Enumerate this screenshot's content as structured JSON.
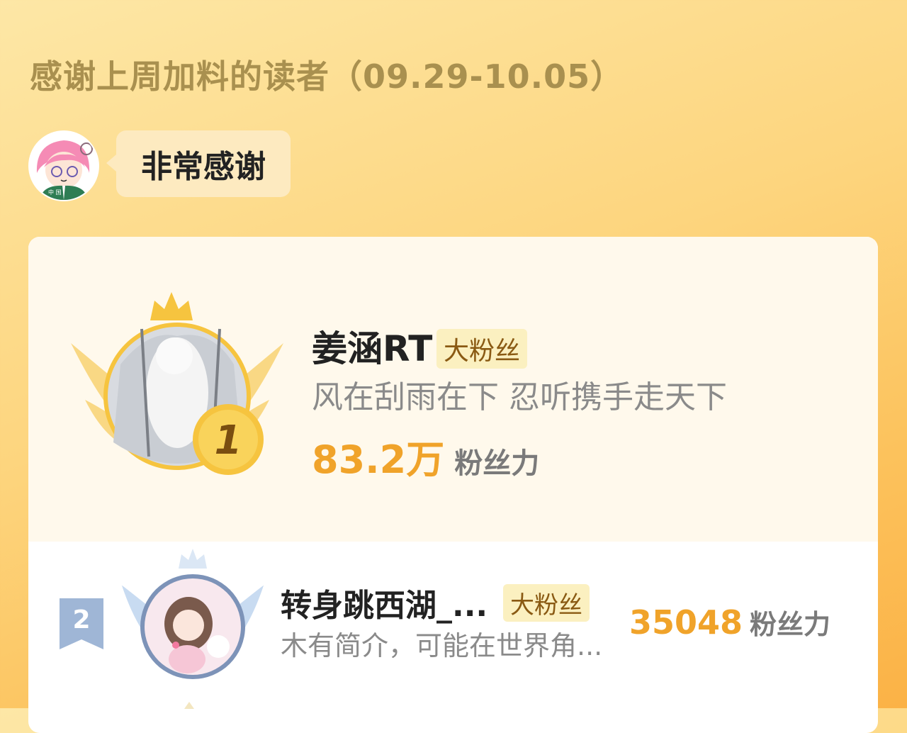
{
  "header": {
    "title": "感谢上周加料的读者（09.29-10.05）"
  },
  "thanks": {
    "text": "非常感谢",
    "avatar_icon": "host-avatar-icon",
    "avatar_flag_text": "中 国"
  },
  "ranking": [
    {
      "rank": "1",
      "name": "姜涵RT",
      "badge": "大粉丝",
      "bio": "风在刮雨在下 忍听携手走天下",
      "score": "83.2万",
      "unit": "粉丝力"
    },
    {
      "rank": "2",
      "name": "转身跳西湖_...",
      "badge": "大粉丝",
      "bio": "木有简介，可能在世界角...",
      "score": "35048",
      "unit": "粉丝力"
    }
  ],
  "colors": {
    "accent": "#f0a32a",
    "gold": "#f6c43f",
    "silver_blue": "#8fa6c6"
  }
}
